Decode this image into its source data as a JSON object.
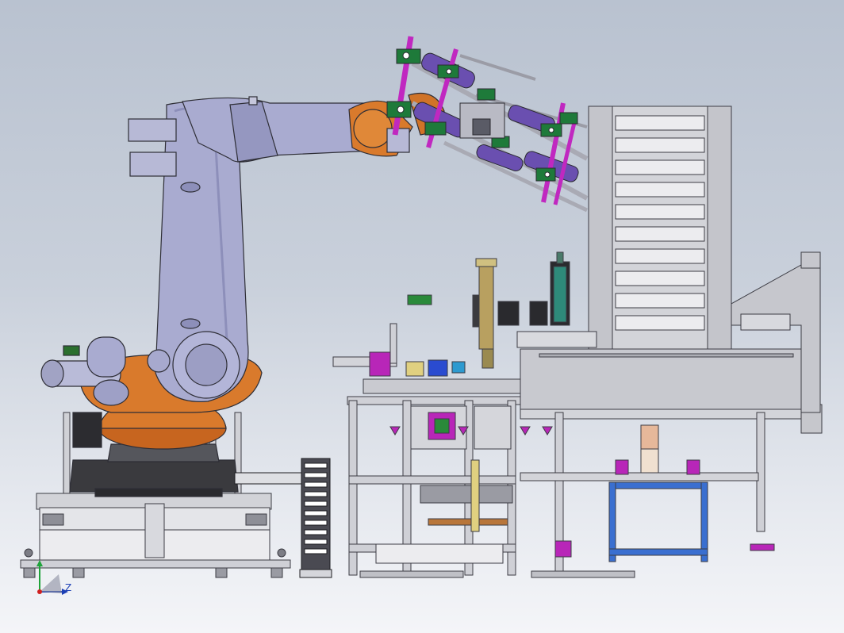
{
  "viewport": {
    "background_top": "#b9c2d0",
    "background_bottom": "#f4f5f8"
  },
  "colors": {
    "robot_body": "#a9abd0",
    "robot_shade": "#8d8fba",
    "robot_orange": "#d97a2c",
    "robot_dark": "#3a3a3e",
    "frame_metal": "#c8c9cf",
    "frame_line": "#3c3c44",
    "gripper_magenta": "#c028c0",
    "gripper_green": "#1e7a3a",
    "gripper_purple": "#6a4fb0",
    "base_blue": "#3a6fd0",
    "axis_y": "#1fa33a",
    "axis_z": "#1c3fb5",
    "axis_origin": "#d02020"
  },
  "axis_triad": {
    "z_label": "Z"
  }
}
